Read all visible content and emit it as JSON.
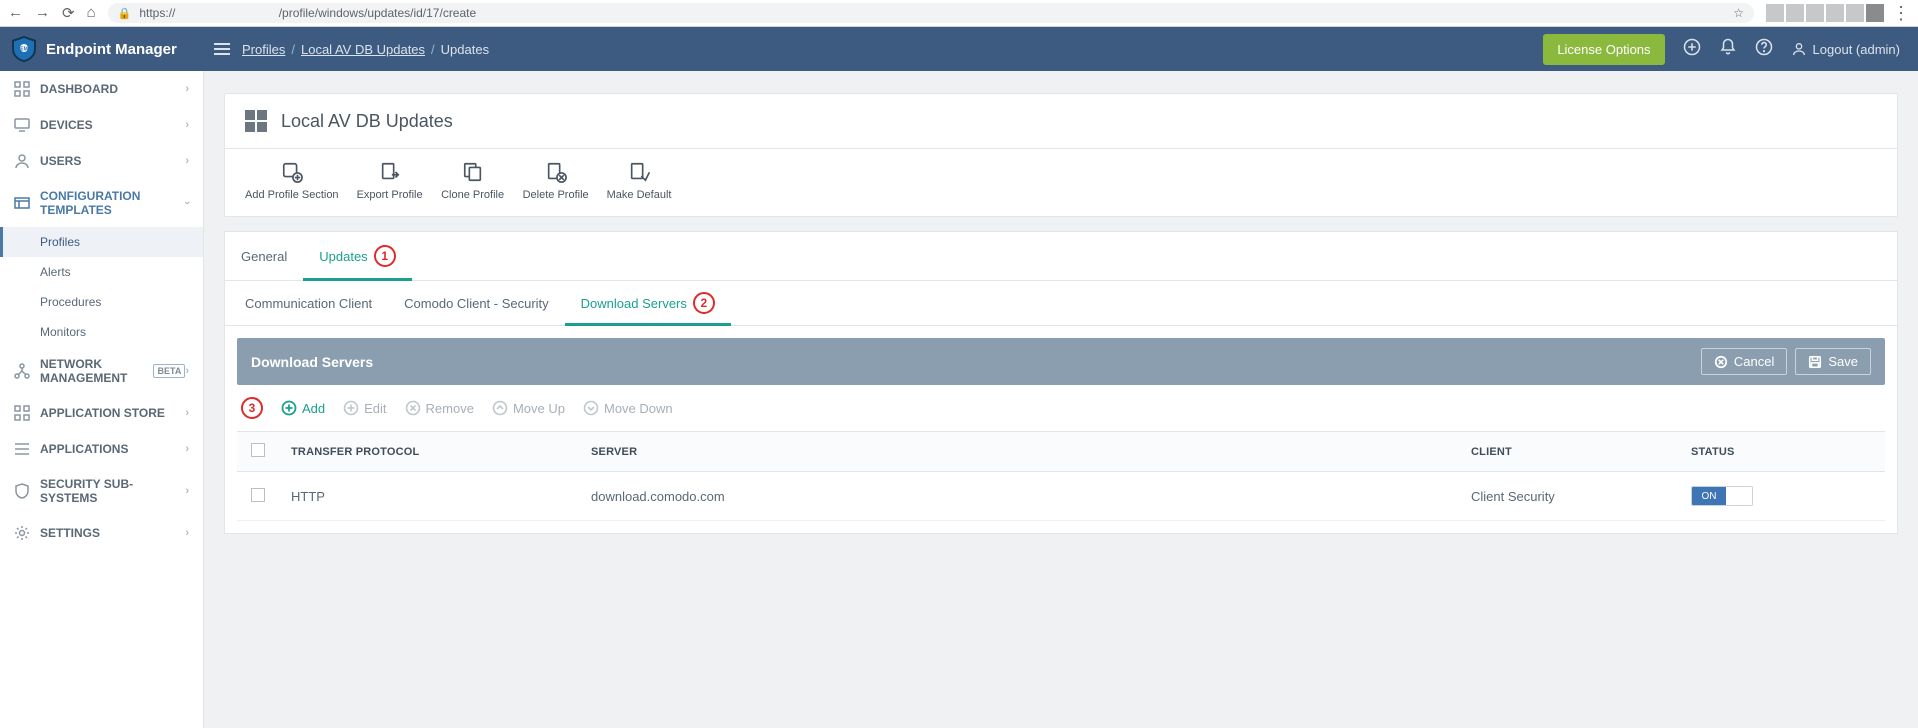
{
  "browser": {
    "url": "https://                               /profile/windows/updates/id/17/create"
  },
  "brand": {
    "name": "Endpoint Manager"
  },
  "header": {
    "breadcrumbs": [
      {
        "label": "Profiles",
        "link": true
      },
      {
        "label": "Local AV DB Updates",
        "link": true
      },
      {
        "label": "Updates",
        "link": false
      }
    ],
    "license_btn": "License Options",
    "logout": "Logout (admin)"
  },
  "sidebar": {
    "items": [
      {
        "label": "DASHBOARD",
        "icon": "grid"
      },
      {
        "label": "DEVICES",
        "icon": "device"
      },
      {
        "label": "USERS",
        "icon": "user"
      },
      {
        "label": "CONFIGURATION TEMPLATES",
        "icon": "templates",
        "active": true,
        "children": [
          {
            "label": "Profiles",
            "active": true
          },
          {
            "label": "Alerts"
          },
          {
            "label": "Procedures"
          },
          {
            "label": "Monitors"
          }
        ]
      },
      {
        "label": "NETWORK MANAGEMENT",
        "icon": "network",
        "badge": "BETA"
      },
      {
        "label": "APPLICATION STORE",
        "icon": "apps"
      },
      {
        "label": "APPLICATIONS",
        "icon": "list"
      },
      {
        "label": "SECURITY SUB-SYSTEMS",
        "icon": "shield"
      },
      {
        "label": "SETTINGS",
        "icon": "gear"
      }
    ]
  },
  "page": {
    "title": "Local AV DB Updates",
    "actions": [
      {
        "label": "Add Profile Section"
      },
      {
        "label": "Export Profile"
      },
      {
        "label": "Clone Profile"
      },
      {
        "label": "Delete Profile"
      },
      {
        "label": "Make Default"
      }
    ],
    "tabs": [
      {
        "label": "General"
      },
      {
        "label": "Updates",
        "active": true
      }
    ],
    "subtabs": [
      {
        "label": "Communication Client"
      },
      {
        "label": "Comodo Client - Security"
      },
      {
        "label": "Download Servers",
        "active": true
      }
    ],
    "panel": {
      "title": "Download Servers",
      "cancel": "Cancel",
      "save": "Save",
      "toolbar": {
        "add": "Add",
        "edit": "Edit",
        "remove": "Remove",
        "move_up": "Move Up",
        "move_down": "Move Down"
      },
      "columns": {
        "protocol": "TRANSFER PROTOCOL",
        "server": "SERVER",
        "client": "CLIENT",
        "status": "STATUS"
      },
      "rows": [
        {
          "protocol": "HTTP",
          "server": "download.comodo.com",
          "client": "Client Security",
          "status": "ON"
        }
      ]
    }
  },
  "callouts": {
    "c1": "1",
    "c2": "2",
    "c3": "3"
  }
}
